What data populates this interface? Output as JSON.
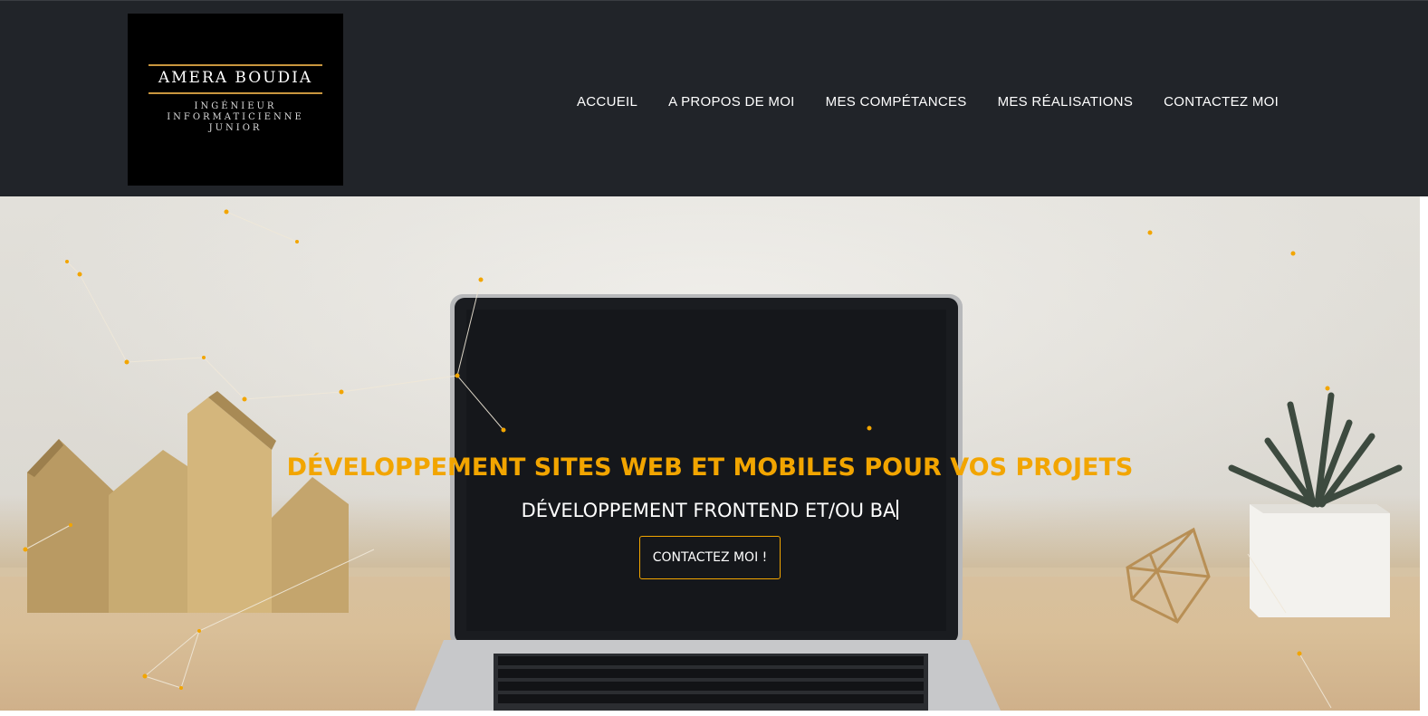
{
  "logo": {
    "name": "AMERA BOUDIA",
    "line1": "INGÉNIEUR",
    "line2": "INFORMATICIENNE",
    "line3": "JUNIOR"
  },
  "nav": {
    "items": [
      {
        "label": "ACCUEIL"
      },
      {
        "label": "A PROPOS DE MOI"
      },
      {
        "label": "MES COMPÉTANCES"
      },
      {
        "label": "MES RÉALISATIONS"
      },
      {
        "label": "CONTACTEZ MOI"
      }
    ]
  },
  "hero": {
    "headline": "DÉVELOPPEMENT SITES WEB ET MOBILES POUR VOS PROJETS",
    "typed_text": "DÉVELOPPEMENT FRONTEND ET/OU BA",
    "cta_label": "CONTACTEZ MOI !"
  },
  "colors": {
    "header_bg": "#212429",
    "accent": "#f2a500",
    "logo_gold": "#c9963e"
  }
}
